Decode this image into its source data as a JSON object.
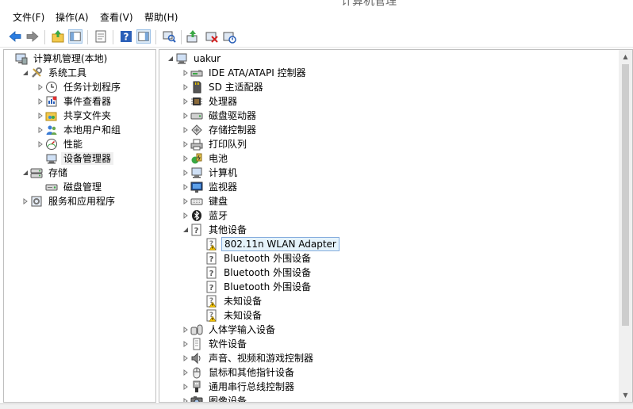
{
  "window": {
    "title": "计算机管理"
  },
  "menu": [
    "文件(F)",
    "操作(A)",
    "查看(V)",
    "帮助(H)"
  ],
  "toolbar": {
    "icons": [
      "back-arrow-icon",
      "forward-arrow-icon",
      "up-folder-icon",
      "show-hide-tree-icon",
      "properties-icon",
      "help-icon",
      "action-pane-icon",
      "scan-hardware-icon",
      "update-driver-icon",
      "uninstall-device-icon",
      "disable-device-icon"
    ]
  },
  "left_tree": [
    {
      "label": "计算机管理(本地)",
      "level": 0,
      "expander": "none",
      "icon": "computer-management-icon"
    },
    {
      "label": "系统工具",
      "level": 1,
      "expander": "open",
      "icon": "system-tools-icon"
    },
    {
      "label": "任务计划程序",
      "level": 2,
      "expander": "closed",
      "icon": "clock-icon"
    },
    {
      "label": "事件查看器",
      "level": 2,
      "expander": "closed",
      "icon": "event-viewer-icon"
    },
    {
      "label": "共享文件夹",
      "level": 2,
      "expander": "closed",
      "icon": "shared-folder-icon"
    },
    {
      "label": "本地用户和组",
      "level": 2,
      "expander": "closed",
      "icon": "users-icon"
    },
    {
      "label": "性能",
      "level": 2,
      "expander": "closed",
      "icon": "performance-gauge-icon"
    },
    {
      "label": "设备管理器",
      "level": 2,
      "expander": "none",
      "icon": "device-manager-icon",
      "state": "highlight"
    },
    {
      "label": "存储",
      "level": 1,
      "expander": "open",
      "icon": "storage-icon"
    },
    {
      "label": "磁盘管理",
      "level": 2,
      "expander": "none",
      "icon": "disk-management-icon"
    },
    {
      "label": "服务和应用程序",
      "level": 1,
      "expander": "closed",
      "icon": "services-icon"
    }
  ],
  "right_tree": [
    {
      "label": "uakur",
      "level": 0,
      "expander": "open",
      "icon": "computer-icon"
    },
    {
      "label": "IDE ATA/ATAPI 控制器",
      "level": 1,
      "expander": "closed",
      "icon": "ide-controller-icon"
    },
    {
      "label": "SD 主适配器",
      "level": 1,
      "expander": "closed",
      "icon": "sd-adapter-icon"
    },
    {
      "label": "处理器",
      "level": 1,
      "expander": "closed",
      "icon": "processor-icon"
    },
    {
      "label": "磁盘驱动器",
      "level": 1,
      "expander": "closed",
      "icon": "disk-drive-icon"
    },
    {
      "label": "存储控制器",
      "level": 1,
      "expander": "closed",
      "icon": "storage-controller-icon"
    },
    {
      "label": "打印队列",
      "level": 1,
      "expander": "closed",
      "icon": "printer-icon"
    },
    {
      "label": "电池",
      "level": 1,
      "expander": "closed",
      "icon": "battery-icon"
    },
    {
      "label": "计算机",
      "level": 1,
      "expander": "closed",
      "icon": "computer-icon"
    },
    {
      "label": "监视器",
      "level": 1,
      "expander": "closed",
      "icon": "monitor-icon"
    },
    {
      "label": "键盘",
      "level": 1,
      "expander": "closed",
      "icon": "keyboard-icon"
    },
    {
      "label": "蓝牙",
      "level": 1,
      "expander": "closed",
      "icon": "bluetooth-icon"
    },
    {
      "label": "其他设备",
      "level": 1,
      "expander": "open",
      "icon": "unknown-device-icon"
    },
    {
      "label": "802.11n WLAN Adapter",
      "level": 2,
      "expander": "none",
      "icon": "warning-device-icon",
      "state": "selected"
    },
    {
      "label": "Bluetooth 外围设备",
      "level": 2,
      "expander": "none",
      "icon": "unknown-device-icon"
    },
    {
      "label": "Bluetooth 外围设备",
      "level": 2,
      "expander": "none",
      "icon": "unknown-device-icon"
    },
    {
      "label": "Bluetooth 外围设备",
      "level": 2,
      "expander": "none",
      "icon": "unknown-device-icon"
    },
    {
      "label": "未知设备",
      "level": 2,
      "expander": "none",
      "icon": "warning-device-icon"
    },
    {
      "label": "未知设备",
      "level": 2,
      "expander": "none",
      "icon": "warning-device-icon"
    },
    {
      "label": "人体学输入设备",
      "level": 1,
      "expander": "closed",
      "icon": "hid-icon"
    },
    {
      "label": "软件设备",
      "level": 1,
      "expander": "closed",
      "icon": "software-device-icon"
    },
    {
      "label": "声音、视频和游戏控制器",
      "level": 1,
      "expander": "closed",
      "icon": "speaker-icon"
    },
    {
      "label": "鼠标和其他指针设备",
      "level": 1,
      "expander": "closed",
      "icon": "mouse-icon"
    },
    {
      "label": "通用串行总线控制器",
      "level": 1,
      "expander": "closed",
      "icon": "usb-icon"
    },
    {
      "label": "图像设备",
      "level": 1,
      "expander": "closed",
      "icon": "camera-icon"
    }
  ],
  "colors": {
    "selection_bg": "#e5f3fb",
    "selection_border": "#84acdd",
    "accent": "#1e6fd9",
    "warning": "#f5c400"
  }
}
